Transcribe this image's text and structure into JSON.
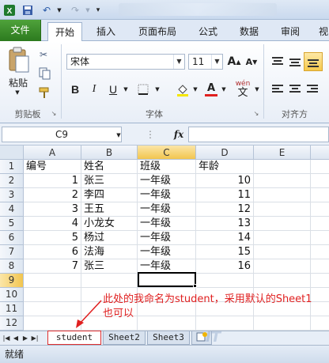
{
  "tabs": [
    "文件",
    "开始",
    "插入",
    "页面布局",
    "公式",
    "数据",
    "审阅",
    "视"
  ],
  "ribbon": {
    "paste_label": "粘贴",
    "clipboard_label": "剪贴板",
    "font_name": "宋体",
    "font_size": "11",
    "font_group_label": "字体",
    "align_group_label": "对齐方",
    "bold": "B",
    "italic": "I",
    "underline": "U",
    "grow_font": "A",
    "shrink_font": "A",
    "wen": "wén",
    "wen_char": "文"
  },
  "formula_bar": {
    "name_box": "C9",
    "fx": "fx",
    "value": ""
  },
  "columns": [
    "A",
    "B",
    "C",
    "D",
    "E"
  ],
  "rows": [
    "1",
    "2",
    "3",
    "4",
    "5",
    "6",
    "7",
    "8",
    "9",
    "10",
    "11",
    "12"
  ],
  "headers": [
    "编号",
    "姓名",
    "班级",
    "年龄"
  ],
  "records": [
    {
      "id": "1",
      "name": "张三",
      "class": "一年级",
      "age": "10"
    },
    {
      "id": "2",
      "name": "李四",
      "class": "一年级",
      "age": "11"
    },
    {
      "id": "3",
      "name": "王五",
      "class": "一年级",
      "age": "12"
    },
    {
      "id": "4",
      "name": "小龙女",
      "class": "一年级",
      "age": "13"
    },
    {
      "id": "5",
      "name": "杨过",
      "class": "一年级",
      "age": "14"
    },
    {
      "id": "6",
      "name": "法海",
      "class": "一年级",
      "age": "15"
    },
    {
      "id": "7",
      "name": "张三",
      "class": "一年级",
      "age": "16"
    }
  ],
  "sheets": [
    "student",
    "Sheet2",
    "Sheet3"
  ],
  "annotation": "此处的我命名为student，采用默认的Sheet1也可以",
  "status": "就绪",
  "colors": {
    "file_tab": "#2c7a1e",
    "selection": "#f2c54f",
    "annotation": "#e02020"
  }
}
